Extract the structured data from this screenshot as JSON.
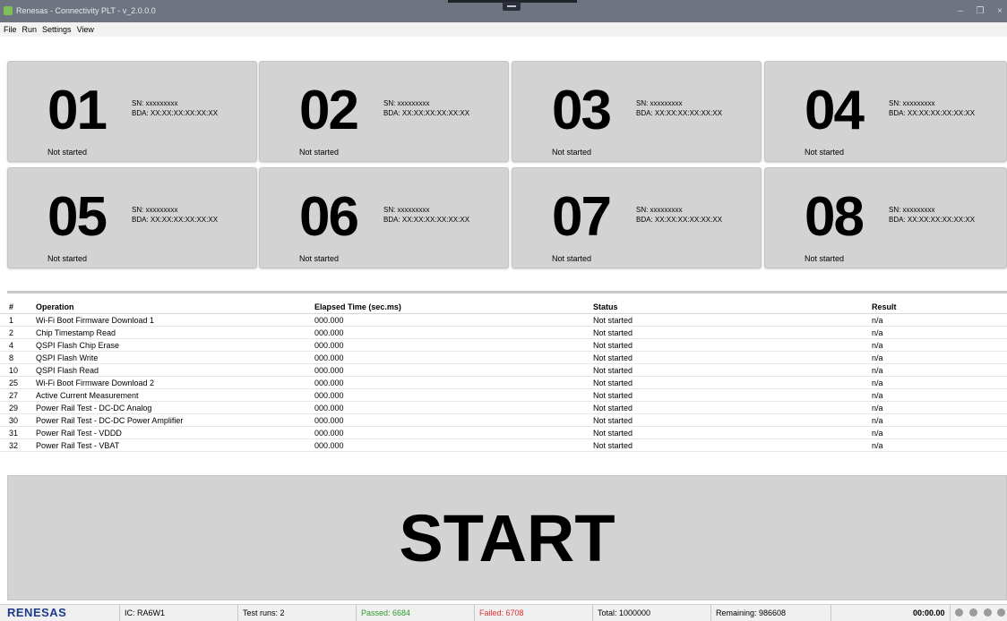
{
  "window": {
    "title": "Renesas - Connectivity PLT - v_2.0.0.0",
    "minimize_glyph": "–",
    "restore_glyph": "❐",
    "close_glyph": "×"
  },
  "menu": [
    "File",
    "Run",
    "Settings",
    "View"
  ],
  "stations": [
    {
      "number": "01",
      "sn": "SN: xxxxxxxxx",
      "bda": "BDA: XX:XX:XX:XX:XX:XX",
      "state": "Not started"
    },
    {
      "number": "02",
      "sn": "SN: xxxxxxxxx",
      "bda": "BDA: XX:XX:XX:XX:XX:XX",
      "state": "Not started"
    },
    {
      "number": "03",
      "sn": "SN: xxxxxxxxx",
      "bda": "BDA: XX:XX:XX:XX:XX:XX",
      "state": "Not started"
    },
    {
      "number": "04",
      "sn": "SN: xxxxxxxxx",
      "bda": "BDA: XX:XX:XX:XX:XX:XX",
      "state": "Not started"
    },
    {
      "number": "05",
      "sn": "SN: xxxxxxxxx",
      "bda": "BDA: XX:XX:XX:XX:XX:XX",
      "state": "Not started"
    },
    {
      "number": "06",
      "sn": "SN: xxxxxxxxx",
      "bda": "BDA: XX:XX:XX:XX:XX:XX",
      "state": "Not started"
    },
    {
      "number": "07",
      "sn": "SN: xxxxxxxxx",
      "bda": "BDA: XX:XX:XX:XX:XX:XX",
      "state": "Not started"
    },
    {
      "number": "08",
      "sn": "SN: xxxxxxxxx",
      "bda": "BDA: XX:XX:XX:XX:XX:XX",
      "state": "Not started"
    }
  ],
  "table": {
    "headers": [
      "#",
      "Operation",
      "Elapsed Time  (sec.ms)",
      "Status",
      "Result"
    ],
    "rows": [
      [
        "1",
        "Wi-Fi Boot Firmware Download 1",
        "000.000",
        "Not started",
        "n/a"
      ],
      [
        "2",
        "Chip Timestamp Read",
        "000.000",
        "Not started",
        "n/a"
      ],
      [
        "4",
        "QSPI Flash Chip Erase",
        "000.000",
        "Not started",
        "n/a"
      ],
      [
        "8",
        "QSPI Flash Write",
        "000.000",
        "Not started",
        "n/a"
      ],
      [
        "10",
        "QSPI Flash Read",
        "000.000",
        "Not started",
        "n/a"
      ],
      [
        "25",
        "Wi-Fi Boot Firmware Download 2",
        "000.000",
        "Not started",
        "n/a"
      ],
      [
        "27",
        "Active Current Measurement",
        "000.000",
        "Not started",
        "n/a"
      ],
      [
        "29",
        "Power Rail Test - DC-DC Analog",
        "000.000",
        "Not started",
        "n/a"
      ],
      [
        "30",
        "Power Rail Test - DC-DC Power Amplifier",
        "000.000",
        "Not started",
        "n/a"
      ],
      [
        "31",
        "Power Rail Test - VDDD",
        "000.000",
        "Not started",
        "n/a"
      ],
      [
        "32",
        "Power Rail Test - VBAT",
        "000.000",
        "Not started",
        "n/a"
      ]
    ]
  },
  "start_button": {
    "label": "START"
  },
  "status": {
    "logo": "RENESAS",
    "ic": "IC: RA6W1",
    "test_runs": "Test runs: 2",
    "passed": "Passed: 6684",
    "failed": "Failed: 6708",
    "total": "Total: 1000000",
    "remaining": "Remaining: 986608",
    "timer": "00:00.00"
  },
  "colors": {
    "titlebar": "#6f7580",
    "tile": "#d3d3d3",
    "passed": "#2e9a2e",
    "failed": "#e03030",
    "logo": "#1d3a8a",
    "indicator": "#9a9a9a"
  }
}
